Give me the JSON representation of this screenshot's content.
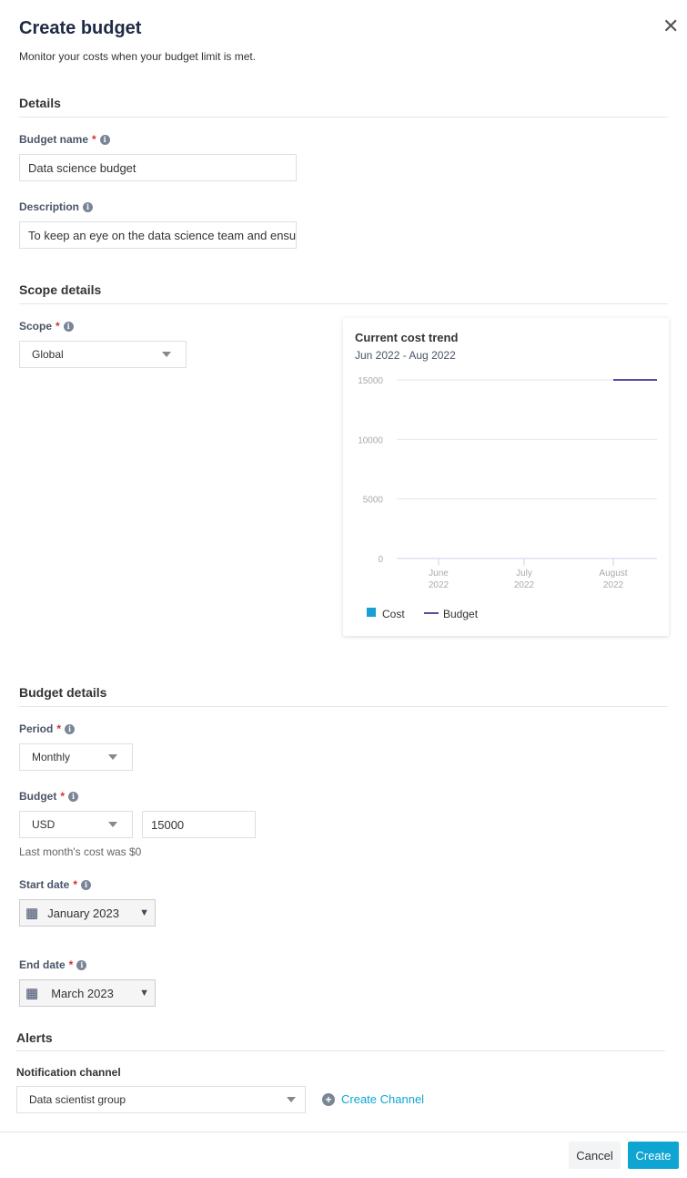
{
  "dialog": {
    "title": "Create budget",
    "subtitle": "Monitor your costs when your budget limit is met."
  },
  "details": {
    "heading": "Details",
    "budget_name_label": "Budget name",
    "budget_name_value": "Data science budget",
    "description_label": "Description",
    "description_value": "To keep an eye on the data science team and ensure"
  },
  "scope": {
    "heading": "Scope details",
    "scope_label": "Scope",
    "scope_value": "Global"
  },
  "chart_data": {
    "type": "line",
    "title": "Current cost trend",
    "subtitle": "Jun 2022 - Aug 2022",
    "categories": [
      "June 2022",
      "July 2022",
      "August 2022"
    ],
    "category_lines": [
      [
        "June",
        "2022"
      ],
      [
        "July",
        "2022"
      ],
      [
        "August",
        "2022"
      ]
    ],
    "yticks": [
      "0",
      "5000",
      "10000",
      "15000"
    ],
    "ylim": [
      0,
      15000
    ],
    "grid": true,
    "legend_placement": "bottom-left",
    "series": [
      {
        "name": "Cost",
        "color": "#1a9fd4",
        "values": []
      },
      {
        "name": "Budget",
        "color": "#5b4a9e",
        "values": [
          null,
          null,
          15000
        ]
      }
    ]
  },
  "budget_details": {
    "heading": "Budget details",
    "period_label": "Period",
    "period_value": "Monthly",
    "budget_label": "Budget",
    "currency_value": "USD",
    "amount_value": "15000",
    "hint": "Last month's cost was $0",
    "start_label": "Start date",
    "start_value": "January 2023",
    "end_label": "End date",
    "end_value": "March 2023"
  },
  "alerts": {
    "heading": "Alerts",
    "channel_label": "Notification channel",
    "channel_value": "Data scientist group",
    "create_channel": "Create Channel"
  },
  "footer": {
    "cancel": "Cancel",
    "create": "Create"
  },
  "colors": {
    "accent": "#0ea5d3",
    "title": "#1f2a44",
    "required": "#d32f2f"
  }
}
